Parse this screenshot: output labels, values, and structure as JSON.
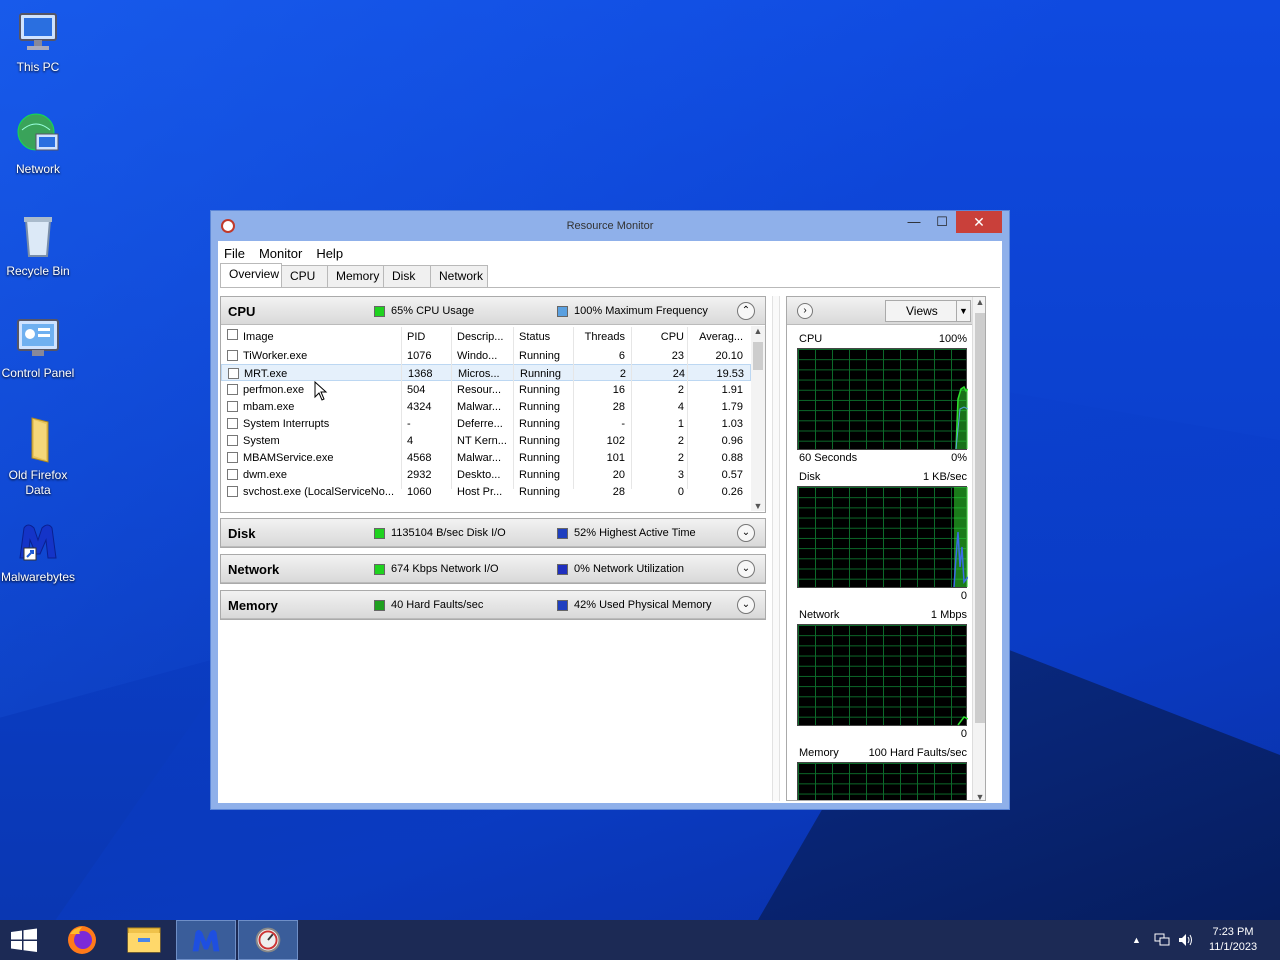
{
  "desktop": {
    "icons": [
      {
        "label": "This PC"
      },
      {
        "label": "Network"
      },
      {
        "label": "Recycle Bin"
      },
      {
        "label": "Control Panel"
      },
      {
        "label": "Old Firefox Data"
      },
      {
        "label": "Malwarebytes"
      }
    ]
  },
  "window": {
    "title": "Resource Monitor",
    "minimize": "—",
    "maximize": "☐",
    "close": "✕"
  },
  "menu": [
    "File",
    "Monitor",
    "Help"
  ],
  "tabs": [
    "Overview",
    "CPU",
    "Memory",
    "Disk",
    "Network"
  ],
  "active_tab": "Overview",
  "sections": {
    "cpu": {
      "name": "CPU",
      "metric1": "65% CPU Usage",
      "metric1_color": "#1fd21f",
      "metric2": "100% Maximum Frequency",
      "metric2_color": "#5aa0e0",
      "toggle": "⌃"
    },
    "disk": {
      "name": "Disk",
      "metric1": "1135104 B/sec Disk I/O",
      "metric1_color": "#1fd21f",
      "metric2": "52% Highest Active Time",
      "metric2_color": "#1f3fbf",
      "toggle": "⌄"
    },
    "network": {
      "name": "Network",
      "metric1": "674 Kbps Network I/O",
      "metric1_color": "#1fd21f",
      "metric2": "0% Network Utilization",
      "metric2_color": "#1f2fbf",
      "toggle": "⌄"
    },
    "memory": {
      "name": "Memory",
      "metric1": "40 Hard Faults/sec",
      "metric1_color": "#1fa01f",
      "metric2": "42% Used Physical Memory",
      "metric2_color": "#1f3fbf",
      "toggle": "⌄"
    }
  },
  "process_table": {
    "headers": {
      "image": "Image",
      "pid": "PID",
      "desc": "Descrip...",
      "status": "Status",
      "threads": "Threads",
      "cpu": "CPU",
      "avg": "Averag..."
    },
    "rows": [
      {
        "image": "TiWorker.exe",
        "pid": "1076",
        "desc": "Windo...",
        "status": "Running",
        "threads": "6",
        "cpu": "23",
        "avg": "20.10"
      },
      {
        "image": "MRT.exe",
        "pid": "1368",
        "desc": "Micros...",
        "status": "Running",
        "threads": "2",
        "cpu": "24",
        "avg": "19.53"
      },
      {
        "image": "perfmon.exe",
        "pid": "504",
        "desc": "Resour...",
        "status": "Running",
        "threads": "16",
        "cpu": "2",
        "avg": "1.91"
      },
      {
        "image": "mbam.exe",
        "pid": "4324",
        "desc": "Malwar...",
        "status": "Running",
        "threads": "28",
        "cpu": "4",
        "avg": "1.79"
      },
      {
        "image": "System Interrupts",
        "pid": "-",
        "desc": "Deferre...",
        "status": "Running",
        "threads": "-",
        "cpu": "1",
        "avg": "1.03"
      },
      {
        "image": "System",
        "pid": "4",
        "desc": "NT Kern...",
        "status": "Running",
        "threads": "102",
        "cpu": "2",
        "avg": "0.96"
      },
      {
        "image": "MBAMService.exe",
        "pid": "4568",
        "desc": "Malwar...",
        "status": "Running",
        "threads": "101",
        "cpu": "2",
        "avg": "0.88"
      },
      {
        "image": "dwm.exe",
        "pid": "2932",
        "desc": "Deskto...",
        "status": "Running",
        "threads": "20",
        "cpu": "3",
        "avg": "0.57"
      },
      {
        "image": "svchost.exe (LocalServiceNo...",
        "pid": "1060",
        "desc": "Host Pr...",
        "status": "Running",
        "threads": "28",
        "cpu": "0",
        "avg": "0.26"
      }
    ]
  },
  "right_panel": {
    "views_label": "Views",
    "graphs": [
      {
        "label": "CPU",
        "max": "100%",
        "footer_left": "60 Seconds",
        "footer_right": "0%"
      },
      {
        "label": "Disk",
        "max": "1 KB/sec",
        "footer_left": "",
        "footer_right": "0"
      },
      {
        "label": "Network",
        "max": "1 Mbps",
        "footer_left": "",
        "footer_right": "0"
      },
      {
        "label": "Memory",
        "max": "100 Hard Faults/sec",
        "footer_left": "",
        "footer_right": ""
      }
    ]
  },
  "taskbar": {
    "time": "7:23 PM",
    "date": "11/1/2023",
    "apps": [
      "start",
      "firefox",
      "file-explorer",
      "malwarebytes",
      "resource-monitor"
    ]
  }
}
